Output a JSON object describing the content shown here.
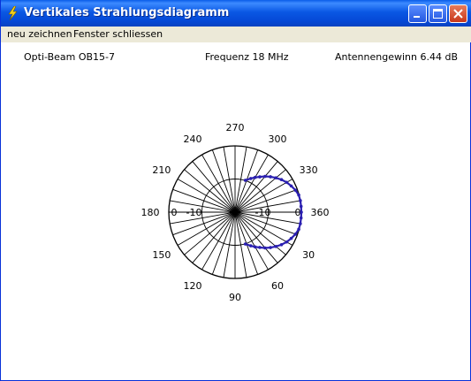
{
  "window": {
    "title": "Vertikales Strahlungsdiagramm",
    "colors": {
      "titlebar": "#0a5ce8",
      "menubar": "#ece9d8",
      "close_button": "#c8371a"
    }
  },
  "menu": [
    {
      "label": "neu zeichnen"
    },
    {
      "label": "Fenster schliessen"
    }
  ],
  "info": {
    "antenna": "Opti-Beam  OB15-7",
    "frequency": "Frequenz 18 MHz",
    "gain": "Antennengewinn 6.44 dB"
  },
  "chart_data": {
    "type": "polar",
    "radial_tick_labels": [
      "0",
      "-10",
      "-10",
      "0"
    ],
    "angle_labels": [
      {
        "text": "270",
        "angle": 270
      },
      {
        "text": "300",
        "angle": 300
      },
      {
        "text": "330",
        "angle": 330
      },
      {
        "text": "360",
        "angle": 0
      },
      {
        "text": "30",
        "angle": 30
      },
      {
        "text": "60",
        "angle": 60
      },
      {
        "text": "90",
        "angle": 90
      },
      {
        "text": "120",
        "angle": 120
      },
      {
        "text": "150",
        "angle": 150
      },
      {
        "text": "180",
        "angle": 180
      },
      {
        "text": "210",
        "angle": 210
      },
      {
        "text": "240",
        "angle": 240
      }
    ],
    "spoke_step_deg": 10,
    "rings_db": [
      0,
      -10,
      -20
    ],
    "db_range": [
      -20,
      0
    ],
    "pattern_color": "#2a1fb0",
    "pattern": {
      "angle_deg": [
        -72,
        -65,
        -60,
        -55,
        -50,
        -45,
        -40,
        -35,
        -30,
        -25,
        -20,
        -15,
        -10,
        -5,
        0,
        5,
        10,
        15,
        20,
        25,
        30,
        35,
        40,
        45,
        50,
        55,
        60,
        65,
        72
      ],
      "gain_db": [
        -9.9,
        -8.8,
        -7.9,
        -7.0,
        -5.9,
        -4.9,
        -3.9,
        -2.9,
        -2.0,
        -1.3,
        -0.6,
        -0.1,
        0.0,
        0.0,
        0.0,
        0.0,
        0.0,
        -0.1,
        -0.6,
        -1.3,
        -2.0,
        -2.9,
        -3.9,
        -4.9,
        -5.9,
        -7.0,
        -7.9,
        -8.8,
        -9.9
      ]
    }
  }
}
